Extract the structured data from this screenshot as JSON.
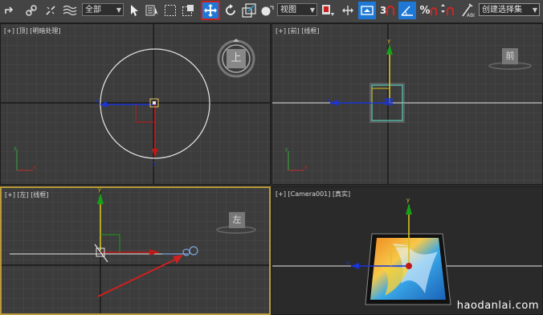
{
  "toolbar": {
    "filter_value": "全部",
    "refcoord_value": "视图",
    "angle_snap_label": "3",
    "percent_snap_label": "%",
    "named_selection_placeholder": "创建选择集",
    "colors": {
      "highlight": "#1e78d6",
      "active_border": "#c82020"
    }
  },
  "viewports": {
    "top": {
      "label": "[+] [顶] [明暗处理]",
      "cube": "上"
    },
    "front": {
      "label": "[+] [前] [线框]",
      "cube": "前"
    },
    "left": {
      "label": "[+] [左] [线框]",
      "cube": "左"
    },
    "camera": {
      "label": "[+] [Camera001] [真实]"
    }
  },
  "gizmo": {
    "y_axis": "y",
    "x_axis": "x",
    "z_axis": "z"
  },
  "watermark": "haodanlai.com"
}
